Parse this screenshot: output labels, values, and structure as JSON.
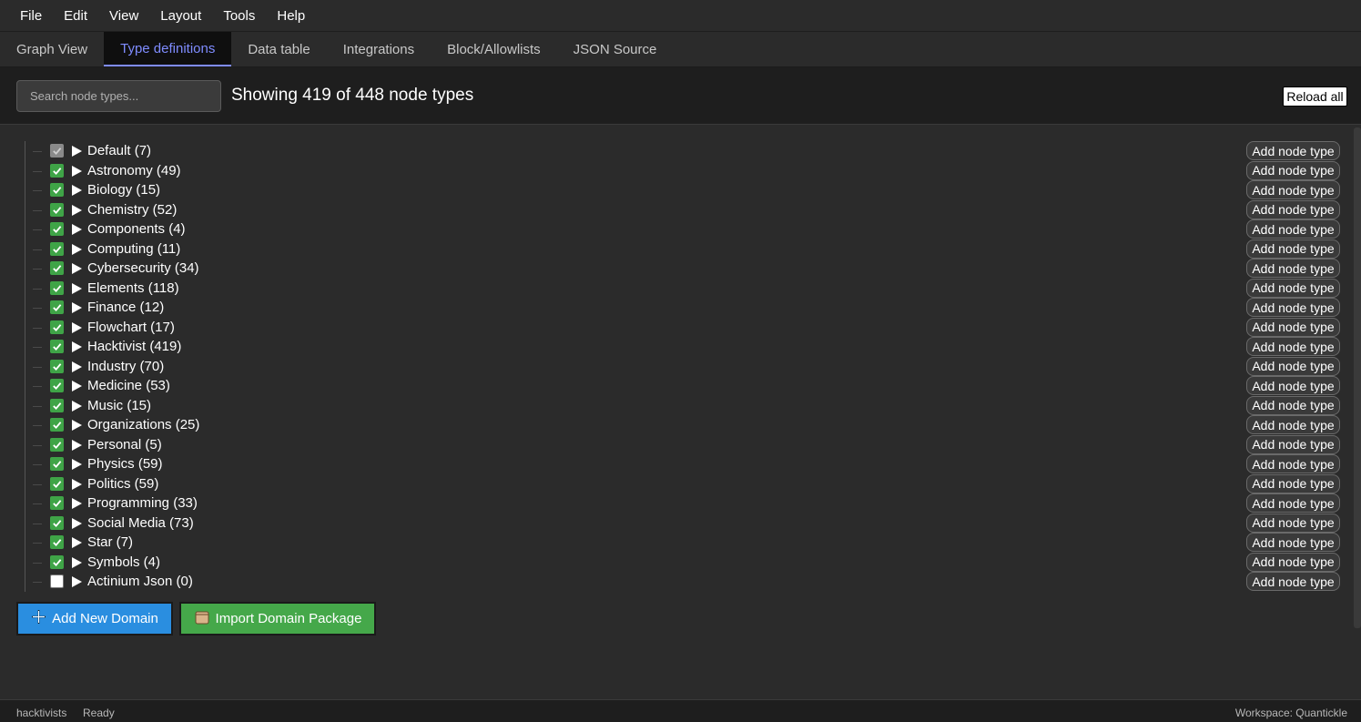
{
  "menu": [
    "File",
    "Edit",
    "View",
    "Layout",
    "Tools",
    "Help"
  ],
  "tabs": [
    {
      "label": "Graph View",
      "active": false
    },
    {
      "label": "Type definitions",
      "active": true
    },
    {
      "label": "Data table",
      "active": false
    },
    {
      "label": "Integrations",
      "active": false
    },
    {
      "label": "Block/Allowlists",
      "active": false
    },
    {
      "label": "JSON Source",
      "active": false
    }
  ],
  "toolbar": {
    "search_placeholder": "Search node types...",
    "showing_text": "Showing 419 of 448 node types",
    "reload_label": "Reload all"
  },
  "domains": [
    {
      "label": "Default (7)",
      "state": "disabled"
    },
    {
      "label": "Astronomy (49)",
      "state": "checked"
    },
    {
      "label": "Biology (15)",
      "state": "checked"
    },
    {
      "label": "Chemistry (52)",
      "state": "checked"
    },
    {
      "label": "Components (4)",
      "state": "checked"
    },
    {
      "label": "Computing (11)",
      "state": "checked"
    },
    {
      "label": "Cybersecurity (34)",
      "state": "checked"
    },
    {
      "label": "Elements (118)",
      "state": "checked"
    },
    {
      "label": "Finance (12)",
      "state": "checked"
    },
    {
      "label": "Flowchart (17)",
      "state": "checked"
    },
    {
      "label": "Hacktivist (419)",
      "state": "checked"
    },
    {
      "label": "Industry (70)",
      "state": "checked"
    },
    {
      "label": "Medicine (53)",
      "state": "checked"
    },
    {
      "label": "Music (15)",
      "state": "checked"
    },
    {
      "label": "Organizations (25)",
      "state": "checked"
    },
    {
      "label": "Personal (5)",
      "state": "checked"
    },
    {
      "label": "Physics (59)",
      "state": "checked"
    },
    {
      "label": "Politics (59)",
      "state": "checked"
    },
    {
      "label": "Programming (33)",
      "state": "checked"
    },
    {
      "label": "Social Media (73)",
      "state": "checked"
    },
    {
      "label": "Star (7)",
      "state": "checked"
    },
    {
      "label": "Symbols (4)",
      "state": "checked"
    },
    {
      "label": "Actinium Json (0)",
      "state": "unchecked"
    }
  ],
  "add_node_type_label": "Add node type",
  "actions": {
    "add_domain_label": "Add New Domain",
    "import_label": "Import Domain Package"
  },
  "status": {
    "left": "hacktivists",
    "ready": "Ready",
    "right": "Workspace: Quantickle"
  },
  "colors": {
    "accent": "#7f8cff",
    "checkbox_green": "#3fa447",
    "add_domain_blue": "#2a8ee0",
    "import_green": "#45a84a"
  }
}
